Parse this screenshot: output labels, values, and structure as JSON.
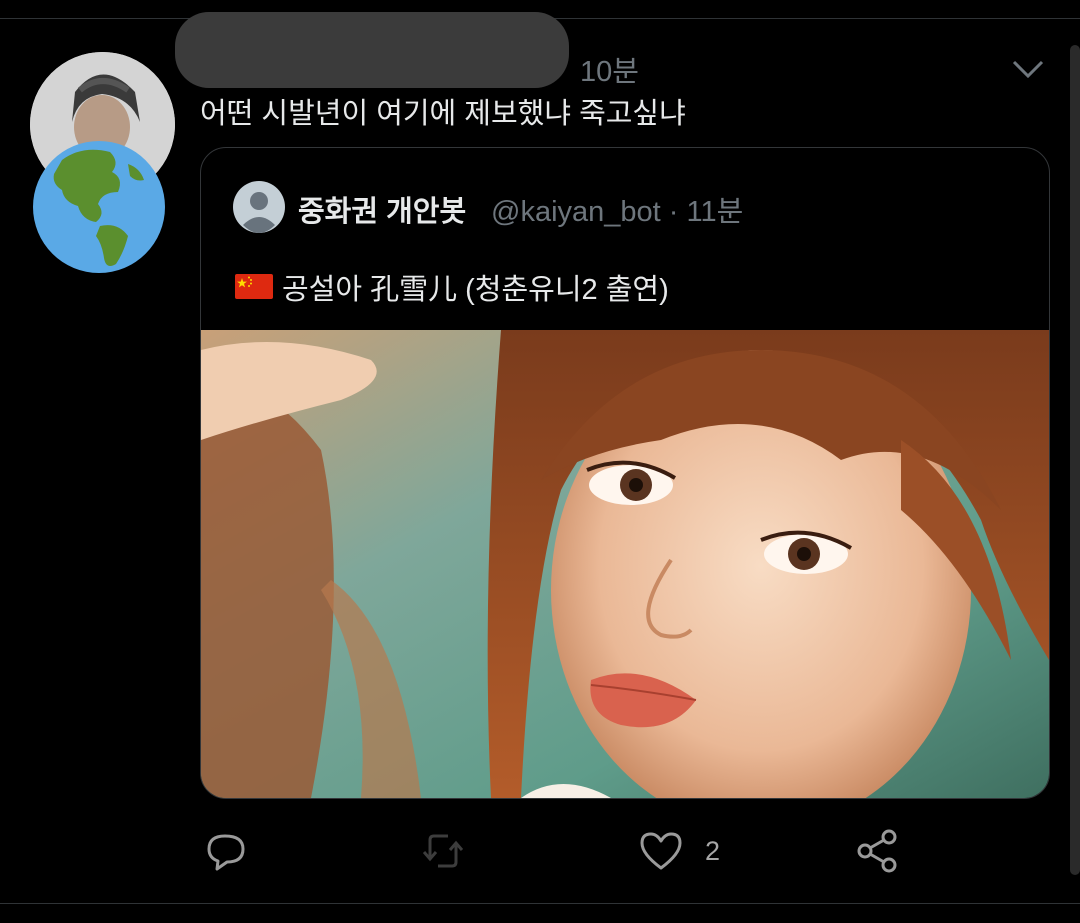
{
  "tweet": {
    "time": "10분",
    "text": "어떤 시발년이 여기에 제보했냐 죽고싶냐"
  },
  "quote": {
    "display_name": "중화권 개안봇",
    "meta": "@kaiyan_bot · 11분",
    "flag": "china-flag-icon",
    "text": "공설아 孔雪儿 (청춘유니2 출연)"
  },
  "actions": {
    "like_count": "2"
  },
  "colors": {
    "background": "#000000",
    "primary_text": "#e7e9ea",
    "secondary_text": "#6e767d",
    "border": "#333639"
  }
}
